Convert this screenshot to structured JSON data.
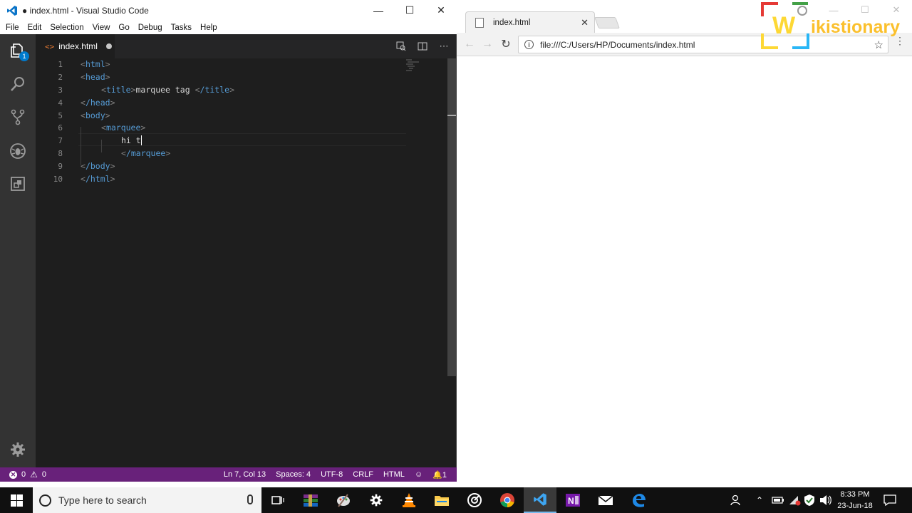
{
  "vscode": {
    "title": "● index.html - Visual Studio Code",
    "menu": [
      "File",
      "Edit",
      "Selection",
      "View",
      "Go",
      "Debug",
      "Tasks",
      "Help"
    ],
    "explorer_badge": "1",
    "tab": {
      "icon": "<>",
      "label": "index.html"
    },
    "lines": [
      {
        "n": "1"
      },
      {
        "n": "2"
      },
      {
        "n": "3"
      },
      {
        "n": "4"
      },
      {
        "n": "5"
      },
      {
        "n": "6"
      },
      {
        "n": "7"
      },
      {
        "n": "8"
      },
      {
        "n": "9"
      },
      {
        "n": "10"
      }
    ],
    "code": {
      "l1_tag": "html",
      "l2_tag": "head",
      "l3_tag_open": "title",
      "l3_text": "marquee tag ",
      "l3_tag_close": "/title",
      "l4_tag": "/head",
      "l5_tag": "body",
      "l6_tag": "marquee",
      "l7_text": "hi t",
      "l8_tag": "/marquee",
      "l9_tag": "/body",
      "l10_tag": "/html"
    },
    "status": {
      "errors": "0",
      "warnings": "0",
      "position": "Ln 7, Col 13",
      "spaces": "Spaces: 4",
      "encoding": "UTF-8",
      "eol": "CRLF",
      "language": "HTML",
      "notifications": "1"
    },
    "colors": {
      "statusbar": "#68217a",
      "editor_bg": "#1e1e1e",
      "activitybar": "#333333",
      "badge": "#007acc"
    }
  },
  "chrome": {
    "tab_label": "index.html",
    "url": "file:///C:/Users/HP/Documents/index.html"
  },
  "logo": {
    "w_letter": "W",
    "rest": "ikistionary"
  },
  "taskbar": {
    "search_placeholder": "Type here to search",
    "time": "8:33 PM",
    "date": "23-Jun-18",
    "icons": [
      "windows-start-icon",
      "task-view-icon",
      "winrar-icon",
      "paint-icon",
      "settings-icon",
      "vlc-icon",
      "file-explorer-icon",
      "groove-icon",
      "chrome-icon",
      "vscode-icon",
      "onenote-icon",
      "mail-icon",
      "edge-icon"
    ]
  }
}
